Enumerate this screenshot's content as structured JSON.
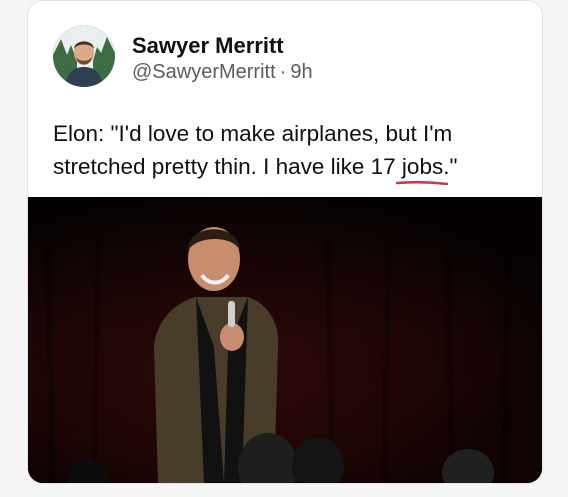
{
  "tweet": {
    "author_name": "Sawyer Merritt",
    "handle": "@SawyerMerritt",
    "separator": "·",
    "time": "9h",
    "text_line1": "Elon: \"I'd love to make airplanes, but I'm",
    "text_line2": "stretched pretty thin. I have like 17 jobs.\"",
    "underline_color": "#d0344a",
    "media_icon": "photo-of-speaker-on-stage"
  },
  "colors": {
    "card_bg": "#ffffff",
    "name": "#111111",
    "meta": "#5c5c5c",
    "media_bg": "#050505",
    "curtain": "#3a0a0a"
  }
}
